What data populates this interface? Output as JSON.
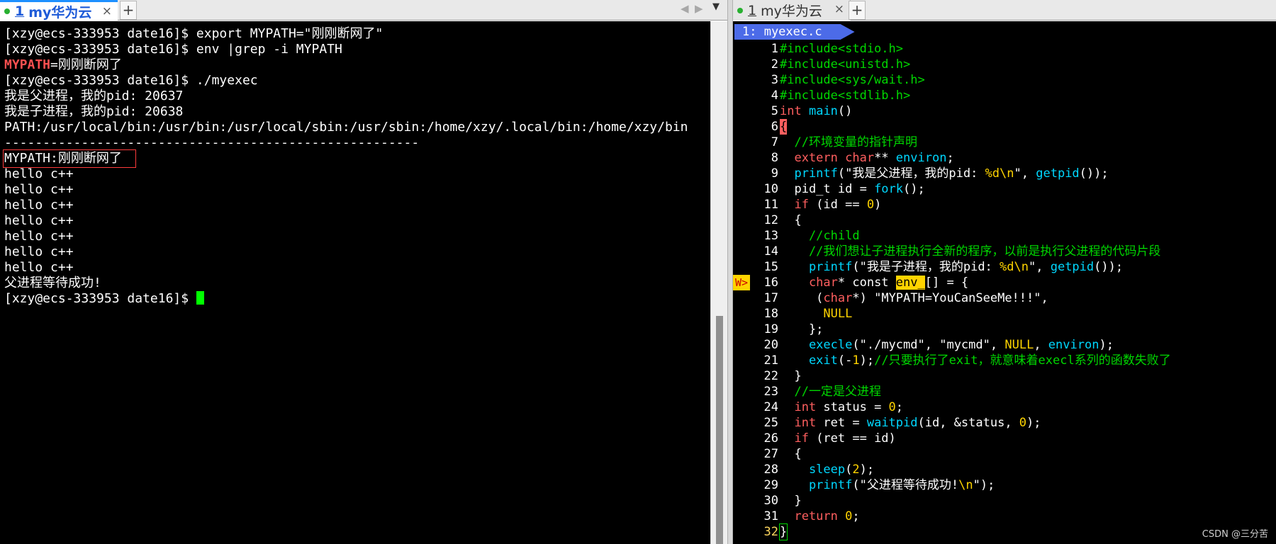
{
  "left_tabbar": {
    "tab": {
      "number": "1",
      "title": "my华为云",
      "close": "×"
    },
    "new_tab": "+",
    "nav_left": "◀",
    "nav_right": "▶",
    "menu": "▼"
  },
  "right_tabbar": {
    "tab": {
      "number": "1",
      "title": "my华为云",
      "close": "×"
    },
    "new_tab": "+"
  },
  "terminal": {
    "lines": [
      "[xzy@ecs-333953 date16]$ export MYPATH=\"刚刚断网了\"",
      "[xzy@ecs-333953 date16]$ env |grep -i MYPATH",
      "=刚刚断网了",
      "[xzy@ecs-333953 date16]$ ./myexec",
      "我是父进程，我的pid: 20637",
      "我是子进程，我的pid: 20638",
      "PATH:/usr/local/bin:/usr/bin:/usr/local/sbin:/usr/sbin:/home/xzy/.local/bin:/home/xzy/bin",
      "------------------------------------------------------",
      "MYPATH:刚刚断网了",
      "hello c++",
      "hello c++",
      "hello c++",
      "hello c++",
      "hello c++",
      "hello c++",
      "hello c++",
      "父进程等待成功!",
      "[xzy@ecs-333953 date16]$ "
    ],
    "grep_match": "MYPATH"
  },
  "vim": {
    "file_tab": "1: myexec.c",
    "warning_sign": "W>",
    "line_numbers": [
      "1",
      "2",
      "3",
      "4",
      "5",
      "6",
      "7",
      "8",
      "9",
      "10",
      "11",
      "12",
      "13",
      "14",
      "15",
      "16",
      "17",
      "18",
      "19",
      "20",
      "21",
      "22",
      "23",
      "24",
      "25",
      "26",
      "27",
      "28",
      "29",
      "30",
      "31",
      "32"
    ],
    "code": {
      "l1": "#include<stdio.h>",
      "l2": "#include<unistd.h>",
      "l3": "#include<sys/wait.h>",
      "l4": "#include<stdlib.h>",
      "l5a": "int",
      "l5b": " ",
      "l5c": "main",
      "l5d": "()",
      "l6": "{",
      "l7": "  //环境变量的指针声明",
      "l8a": "  extern char",
      "l8b": "** ",
      "l8c": "environ",
      "l8d": ";",
      "l9a": "  printf",
      "l9b": "(",
      "l9c": "\"我是父进程，我的pid: ",
      "l9d": "%d\\n",
      "l9e": "\"",
      "l9f": ", ",
      "l9g": "getpid",
      "l9h": "());",
      "l10a": "  pid_t id = ",
      "l10b": "fork",
      "l10c": "();",
      "l11a": "  if",
      "l11b": " (id == ",
      "l11c": "0",
      "l11d": ")",
      "l12": "  {",
      "l13": "    //child",
      "l14": "    //我们想让子进程执行全新的程序，以前是执行父进程的代码片段",
      "l15a": "    printf",
      "l15b": "(",
      "l15c": "\"我是子进程，我的pid: ",
      "l15d": "%d\\n",
      "l15e": "\"",
      "l15f": ", ",
      "l15g": "getpid",
      "l15h": "());",
      "l16a": "    char",
      "l16b": "* const ",
      "l16c": "env_",
      "l16d": "[] = {",
      "l17a": "     (",
      "l17b": "char",
      "l17c": "*) ",
      "l17d": "\"MYPATH=YouCanSeeMe!!!\"",
      "l17e": ",",
      "l18": "      NULL",
      "l19": "    };",
      "l20a": "    execle",
      "l20b": "(",
      "l20c": "\"./mycmd\"",
      "l20d": ", ",
      "l20e": "\"mycmd\"",
      "l20f": ", ",
      "l20g": "NULL",
      "l20h": ", ",
      "l20i": "environ",
      "l20j": ");",
      "l21a": "    exit",
      "l21b": "(-",
      "l21c": "1",
      "l21d": ");",
      "l21e": "//只要执行了exit，就意味着execl系列的函数失败了",
      "l22": "  }",
      "l23": "  //一定是父进程",
      "l24a": "  int",
      "l24b": " status = ",
      "l24c": "0",
      "l24d": ";",
      "l25a": "  int",
      "l25b": " ret = ",
      "l25c": "waitpid",
      "l25d": "(id, &status, ",
      "l25e": "0",
      "l25f": ");",
      "l26a": "  if",
      "l26b": " (ret == id)",
      "l27": "  {",
      "l28a": "    sleep",
      "l28b": "(",
      "l28c": "2",
      "l28d": ");",
      "l29a": "    printf",
      "l29b": "(",
      "l29c": "\"父进程等待成功!",
      "l29d": "\\n",
      "l29e": "\"",
      "l29f": ");",
      "l30": "  }",
      "l31a": "  return",
      "l31b": " ",
      "l31c": "0",
      "l31d": ";",
      "l32": "}"
    }
  },
  "watermark": "CSDN @三分苦"
}
